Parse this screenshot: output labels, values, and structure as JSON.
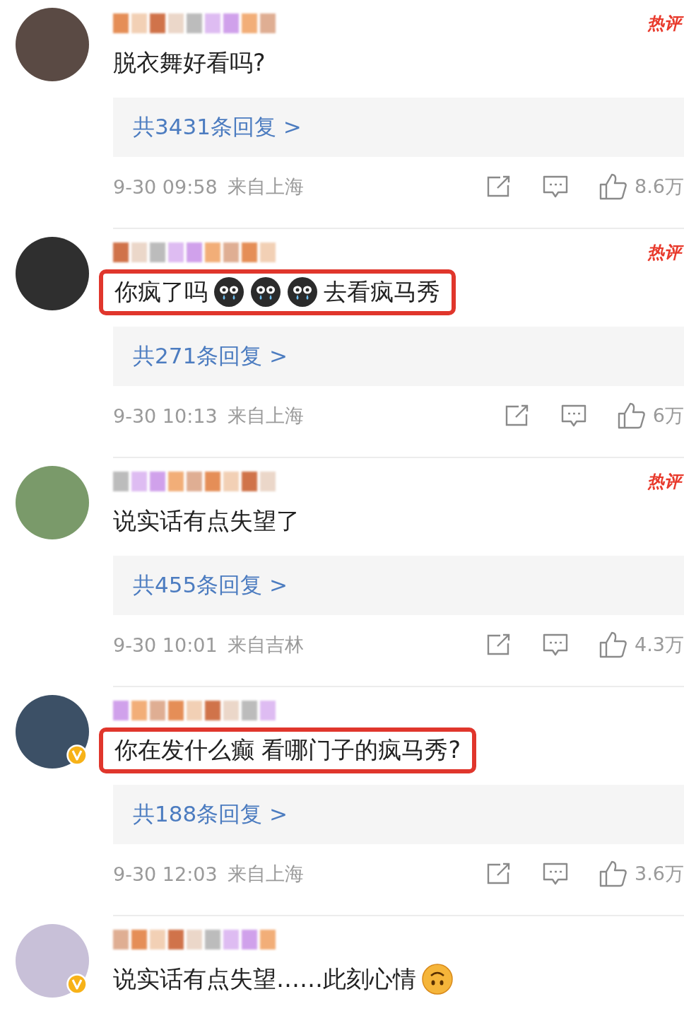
{
  "comments": [
    {
      "badge": "热评",
      "verified": false,
      "highlighted": false,
      "content": [
        {
          "kind": "text",
          "text": "脱衣舞好看吗?"
        }
      ],
      "replies": "共3431条回复 >",
      "time": "9-30 09:58",
      "location": "来自上海",
      "likes": "8.6万"
    },
    {
      "badge": "热评",
      "verified": false,
      "highlighted": true,
      "content": [
        {
          "kind": "text",
          "text": "你疯了吗"
        },
        {
          "kind": "emoji"
        },
        {
          "kind": "emoji"
        },
        {
          "kind": "emoji"
        },
        {
          "kind": "text",
          "text": "去看疯马秀"
        }
      ],
      "replies": "共271条回复 >",
      "time": "9-30 10:13",
      "location": "来自上海",
      "likes": "6万"
    },
    {
      "badge": "热评",
      "verified": false,
      "highlighted": false,
      "content": [
        {
          "kind": "text",
          "text": "说实话有点失望了"
        }
      ],
      "replies": "共455条回复 >",
      "time": "9-30 10:01",
      "location": "来自吉林",
      "likes": "4.3万"
    },
    {
      "verified": true,
      "highlighted": true,
      "content": [
        {
          "kind": "text",
          "text": "你在发什么癫 看哪门子的疯马秀?"
        }
      ],
      "replies": "共188条回复 >",
      "time": "9-30 12:03",
      "location": "来自上海",
      "likes": "3.6万"
    },
    {
      "verified": true,
      "highlighted": false,
      "content": [
        {
          "kind": "text",
          "text": "说实话有点失望……此刻心情"
        },
        {
          "kind": "smiley"
        }
      ]
    }
  ]
}
